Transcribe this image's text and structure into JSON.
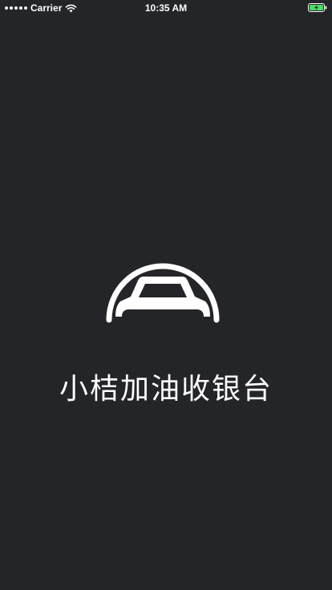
{
  "status_bar": {
    "carrier": "Carrier",
    "time": "10:35 AM",
    "battery_state": "charging",
    "battery_color": "#4cd964",
    "signal_icon": "signal-dots-icon",
    "wifi_icon": "wifi-icon"
  },
  "splash": {
    "logo_icon": "car-dome-logo-icon",
    "app_name": "小桔加油收银台"
  },
  "colors": {
    "background": "#242528",
    "foreground": "#ffffff"
  }
}
